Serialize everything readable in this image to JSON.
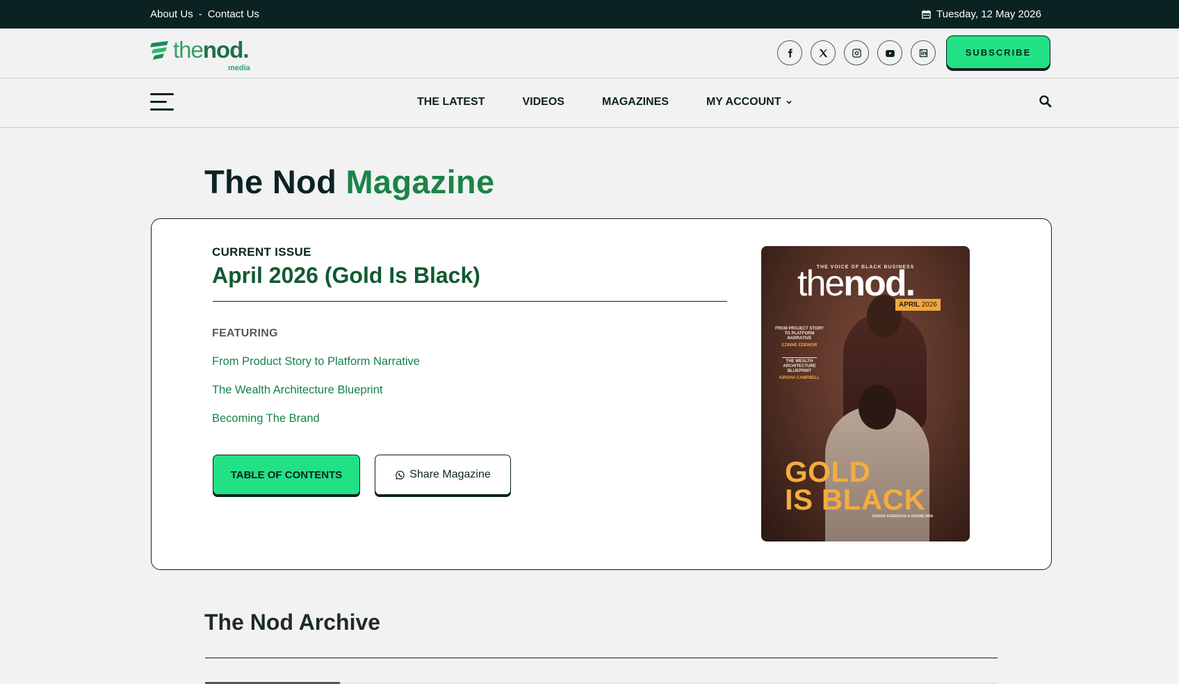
{
  "topbar": {
    "about": "About Us",
    "separator": "-",
    "contact": "Contact Us",
    "date": "Tuesday, 12 May 2026"
  },
  "header": {
    "logo_the": "the",
    "logo_nod": "nod.",
    "logo_sub": "media",
    "subscribe": "SUBSCRIBE",
    "socials": [
      "facebook-icon",
      "x-icon",
      "instagram-icon",
      "youtube-icon",
      "linkedin-icon"
    ]
  },
  "nav": {
    "items": [
      "THE LATEST",
      "VIDEOS",
      "MAGAZINES",
      "MY ACCOUNT"
    ]
  },
  "page": {
    "title_part1": "The Nod",
    "title_part2": "Magazine"
  },
  "issue": {
    "label": "CURRENT ISSUE",
    "title": "April 2026 (Gold Is Black)",
    "featuring_label": "FEATURING",
    "features": [
      "From Product Story to Platform Narrative",
      "The Wealth Architecture Blueprint",
      "Becoming The Brand"
    ],
    "toc_button": "TABLE OF CONTENTS",
    "share_button": "Share Magazine"
  },
  "cover": {
    "tagline": "THE VOICE OF BLACK BUSINESS",
    "mast_the": "the",
    "mast_nod": "nod.",
    "month": "APRIL",
    "year": "2026",
    "story1": "FROM PROJECT STORY TO PLATFORM NARRATIVE",
    "story1_name": "EZINNE EDEWOR",
    "story2": "THE WEALTH ARCHITECTURE BLUEPRINT",
    "story2_name": "KIRSHA CAMPBELL",
    "headline1": "GOLD",
    "headline2": "IS BLACK",
    "byline": "DENNIS AGBENGHA & NADINE MBA"
  },
  "archive": {
    "title": "The Nod Archive"
  },
  "colors": {
    "dark": "#0a2222",
    "accent_green": "#22e184",
    "title_green": "#1a8448",
    "link_green": "#15824a",
    "gold": "#f5ac3f"
  }
}
